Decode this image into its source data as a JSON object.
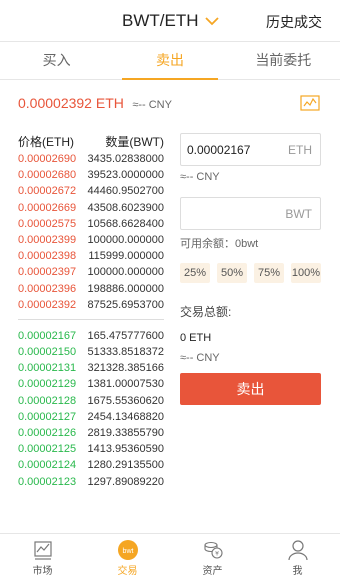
{
  "header": {
    "pair": "BWT/ETH",
    "history": "历史成交"
  },
  "tabs": [
    {
      "label": "买入"
    },
    {
      "label": "卖出"
    },
    {
      "label": "当前委托"
    }
  ],
  "price": {
    "last": "0.00002392 ETH",
    "cny": "≈-- CNY"
  },
  "book": {
    "head_price": "价格(ETH)",
    "head_qty": "数量(BWT)",
    "asks": [
      {
        "price": "0.00002690",
        "qty": "3435.02838000"
      },
      {
        "price": "0.00002680",
        "qty": "39523.0000000"
      },
      {
        "price": "0.00002672",
        "qty": "44460.9502700"
      },
      {
        "price": "0.00002669",
        "qty": "43508.6023900"
      },
      {
        "price": "0.00002575",
        "qty": "10568.6628400"
      },
      {
        "price": "0.00002399",
        "qty": "100000.000000"
      },
      {
        "price": "0.00002398",
        "qty": "115999.000000"
      },
      {
        "price": "0.00002397",
        "qty": "100000.000000"
      },
      {
        "price": "0.00002396",
        "qty": "198886.000000"
      },
      {
        "price": "0.00002392",
        "qty": "87525.6953700"
      }
    ],
    "bids": [
      {
        "price": "0.00002167",
        "qty": "165.475777600"
      },
      {
        "price": "0.00002150",
        "qty": "51333.8518372"
      },
      {
        "price": "0.00002131",
        "qty": "321328.385166"
      },
      {
        "price": "0.00002129",
        "qty": "1381.00007530"
      },
      {
        "price": "0.00002128",
        "qty": "1675.55360620"
      },
      {
        "price": "0.00002127",
        "qty": "2454.13468820"
      },
      {
        "price": "0.00002126",
        "qty": "2819.33855790"
      },
      {
        "price": "0.00002125",
        "qty": "1413.95360590"
      },
      {
        "price": "0.00002124",
        "qty": "1280.29135500"
      },
      {
        "price": "0.00002123",
        "qty": "1297.89089220"
      }
    ]
  },
  "form": {
    "price_value": "0.00002167",
    "price_unit": "ETH",
    "price_cny": "≈-- CNY",
    "amount_value": "",
    "amount_unit": "BWT",
    "available": "可用余额：0bwt",
    "pcts": [
      "25%",
      "50%",
      "75%",
      "100%"
    ],
    "total_label": "交易总额:",
    "total_value": "0 ETH",
    "total_cny": "≈-- CNY",
    "sell_label": "卖出"
  },
  "nav": [
    {
      "label": "市场",
      "icon": "market-icon"
    },
    {
      "label": "交易",
      "icon": "trade-icon"
    },
    {
      "label": "资产",
      "icon": "assets-icon"
    },
    {
      "label": "我",
      "icon": "profile-icon"
    }
  ],
  "colors": {
    "accent": "#f5a623",
    "sell": "#e8553a",
    "buy": "#29b84c"
  }
}
